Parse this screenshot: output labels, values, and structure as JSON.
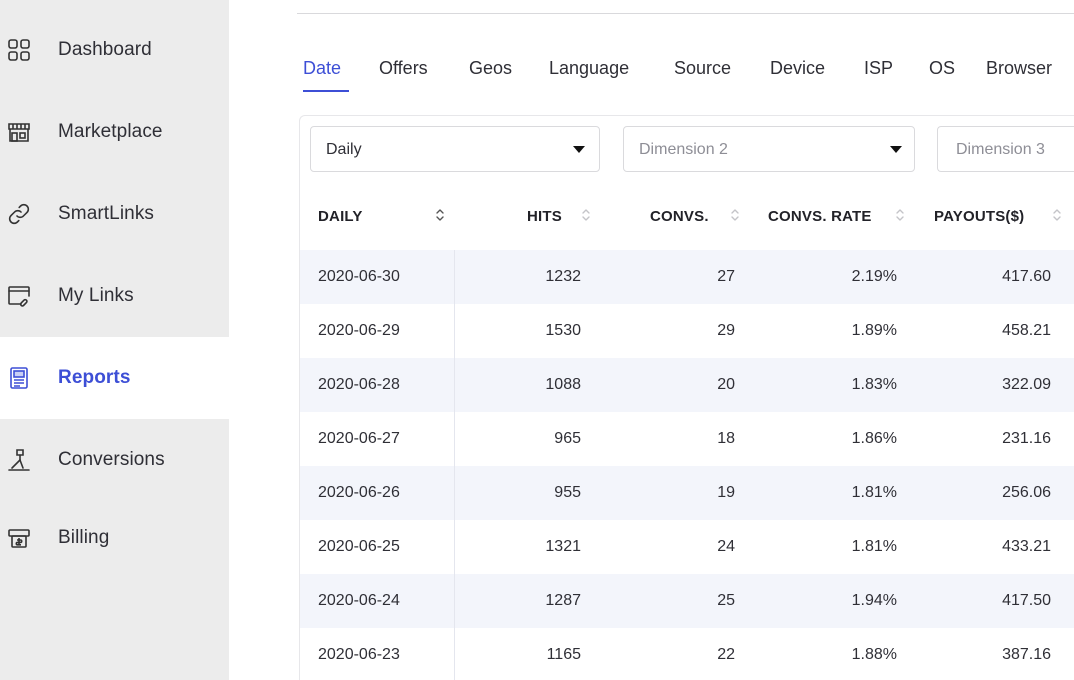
{
  "sidebar": {
    "items": [
      {
        "label": "Dashboard",
        "icon": "grid-icon",
        "active": false
      },
      {
        "label": "Marketplace",
        "icon": "storefront-icon",
        "active": false
      },
      {
        "label": "SmartLinks",
        "icon": "link-icon",
        "active": false
      },
      {
        "label": "My Links",
        "icon": "window-link-icon",
        "active": false
      },
      {
        "label": "Reports",
        "icon": "report-document-icon",
        "active": true
      },
      {
        "label": "Conversions",
        "icon": "funnel-icon",
        "active": false
      },
      {
        "label": "Billing",
        "icon": "cash-register-icon",
        "active": false
      }
    ]
  },
  "tabs": {
    "items": [
      "Date",
      "Offers",
      "Geos",
      "Language",
      "Source",
      "Device",
      "ISP",
      "OS",
      "Browser"
    ],
    "active": "Date"
  },
  "filters": {
    "dimension1": {
      "value": "Daily"
    },
    "dimension2": {
      "placeholder": "Dimension 2"
    },
    "dimension3": {
      "placeholder": "Dimension 3"
    }
  },
  "table": {
    "columns": [
      "DAILY",
      "HITS",
      "CONVS.",
      "CONVS. RATE",
      "PAYOUTS($)"
    ],
    "rows": [
      [
        "2020-06-30",
        "1232",
        "27",
        "2.19%",
        "417.60"
      ],
      [
        "2020-06-29",
        "1530",
        "29",
        "1.89%",
        "458.21"
      ],
      [
        "2020-06-28",
        "1088",
        "20",
        "1.83%",
        "322.09"
      ],
      [
        "2020-06-27",
        "965",
        "18",
        "1.86%",
        "231.16"
      ],
      [
        "2020-06-26",
        "955",
        "19",
        "1.81%",
        "256.06"
      ],
      [
        "2020-06-25",
        "1321",
        "24",
        "1.81%",
        "433.21"
      ],
      [
        "2020-06-24",
        "1287",
        "25",
        "1.94%",
        "417.50"
      ],
      [
        "2020-06-23",
        "1165",
        "22",
        "1.88%",
        "387.16"
      ]
    ]
  },
  "colors": {
    "accent": "#3d4fd6",
    "sidebar_bg": "#ececec",
    "row_alt": "#f3f5fb"
  }
}
